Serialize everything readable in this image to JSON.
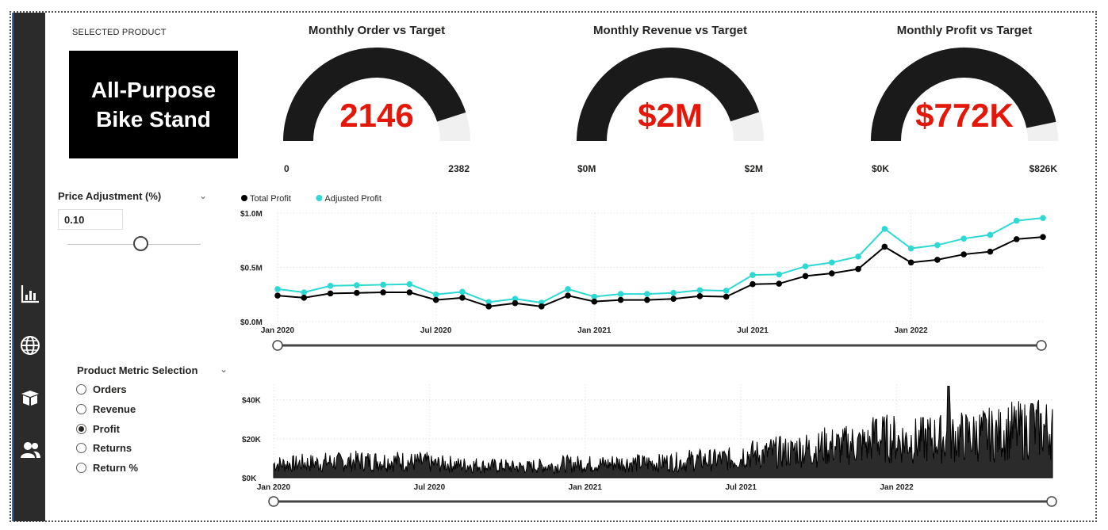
{
  "selected_product": {
    "label": "SELECTED PRODUCT",
    "name_line1": "All-Purpose",
    "name_line2": "Bike Stand"
  },
  "gauges": [
    {
      "title": "Monthly Order vs Target",
      "value": "2146",
      "min": "0",
      "max": "2382",
      "fraction": 0.901
    },
    {
      "title": "Monthly Revenue vs Target",
      "value": "$2M",
      "min": "$0M",
      "max": "$2M",
      "fraction": 0.9
    },
    {
      "title": "Monthly Profit vs Target",
      "value": "$772K",
      "min": "$0K",
      "max": "$826K",
      "fraction": 0.934
    }
  ],
  "price_adjustment": {
    "title": "Price Adjustment (%)",
    "value": "0.10",
    "slider_fraction": 0.55
  },
  "metric_selection": {
    "title": "Product Metric Selection",
    "options": [
      {
        "label": "Orders",
        "checked": false
      },
      {
        "label": "Revenue",
        "checked": false
      },
      {
        "label": "Profit",
        "checked": true
      },
      {
        "label": "Returns",
        "checked": false
      },
      {
        "label": "Return %",
        "checked": false
      }
    ]
  },
  "nav": {
    "icons": [
      "bar-chart-icon",
      "globe-icon",
      "box-icon",
      "users-icon"
    ]
  },
  "colors": {
    "accent": "#e3170a",
    "gauge": "#1a1a1a",
    "gauge_bg": "#f0f0f0",
    "adjusted": "#2ed8d3",
    "total": "#000000"
  },
  "chart_data": [
    {
      "type": "line",
      "legend_position": "top-left",
      "x": [
        "2020-01",
        "2020-02",
        "2020-03",
        "2020-04",
        "2020-05",
        "2020-06",
        "2020-07",
        "2020-08",
        "2020-09",
        "2020-10",
        "2020-11",
        "2020-12",
        "2021-01",
        "2021-02",
        "2021-03",
        "2021-04",
        "2021-05",
        "2021-06",
        "2021-07",
        "2021-08",
        "2021-09",
        "2021-10",
        "2021-11",
        "2021-12",
        "2022-01",
        "2022-02",
        "2022-03",
        "2022-04",
        "2022-05",
        "2022-06"
      ],
      "x_ticks": [
        "Jan 2020",
        "Jul 2020",
        "Jan 2021",
        "Jul 2021",
        "Jan 2022"
      ],
      "y_ticks": [
        "$0.0M",
        "$0.5M",
        "$1.0M"
      ],
      "ylim": [
        0,
        1.0
      ],
      "series": [
        {
          "name": "Total Profit",
          "color": "#000000",
          "values": [
            0.24,
            0.22,
            0.26,
            0.265,
            0.27,
            0.27,
            0.2,
            0.22,
            0.14,
            0.17,
            0.14,
            0.24,
            0.185,
            0.2,
            0.2,
            0.21,
            0.235,
            0.23,
            0.345,
            0.35,
            0.42,
            0.445,
            0.485,
            0.69,
            0.545,
            0.57,
            0.62,
            0.645,
            0.76,
            0.78
          ]
        },
        {
          "name": "Adjusted Profit",
          "color": "#2ed8d3",
          "values": [
            0.3,
            0.27,
            0.33,
            0.335,
            0.34,
            0.345,
            0.25,
            0.275,
            0.18,
            0.21,
            0.175,
            0.3,
            0.23,
            0.255,
            0.255,
            0.265,
            0.29,
            0.285,
            0.43,
            0.435,
            0.51,
            0.545,
            0.6,
            0.855,
            0.675,
            0.705,
            0.765,
            0.8,
            0.93,
            0.955
          ]
        }
      ]
    },
    {
      "type": "area",
      "x_ticks": [
        "Jan 2020",
        "Jul 2020",
        "Jan 2021",
        "Jul 2021",
        "Jan 2022"
      ],
      "y_ticks": [
        "$0K",
        "$20K",
        "$40K"
      ],
      "ylim": [
        0,
        48000
      ],
      "trend": [
        7000,
        7500,
        8000,
        8500,
        8500,
        8000,
        7000,
        6500,
        6000,
        5500,
        6000,
        7000,
        7000,
        7500,
        7500,
        8000,
        9000,
        9500,
        12000,
        13000,
        14500,
        16000,
        17000,
        20000,
        19000,
        20000,
        21000,
        22000,
        24000,
        25000
      ],
      "spikes": [
        {
          "month_index": 23.2,
          "value": 30000
        },
        {
          "month_index": 26.0,
          "value": 47000
        },
        {
          "month_index": 29.2,
          "value": 38000
        }
      ]
    }
  ]
}
